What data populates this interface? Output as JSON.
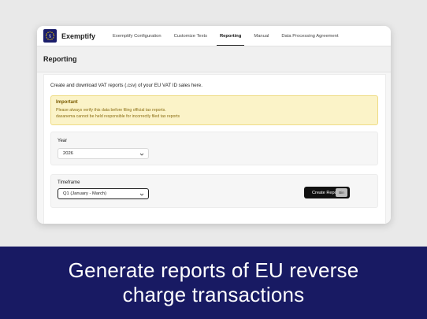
{
  "app": {
    "brand": "Exemptify",
    "nav": [
      {
        "label": "Exemptify Configuration",
        "active": false
      },
      {
        "label": "Customize Texts",
        "active": false
      },
      {
        "label": "Reporting",
        "active": true
      },
      {
        "label": "Manual",
        "active": false
      },
      {
        "label": "Data Processing Agreement",
        "active": false
      }
    ]
  },
  "page": {
    "title": "Reporting",
    "intro": "Create and download VAT reports (.csv) of your EU VAT ID sales here.",
    "notice": {
      "title": "Important",
      "line1": "Please always verify this data before filing official tax reports.",
      "line2": "daxanema cannot be held responsible for incorrectly filed tax reports"
    },
    "year": {
      "label": "Year",
      "value": "2026"
    },
    "timeframe": {
      "label": "Timeframe",
      "value": "Q1 (January - March)"
    },
    "create_button": "Create Report",
    "bin_label": "Bin"
  },
  "banner": {
    "line1": "Generate reports of EU reverse",
    "line2": "charge transactions"
  },
  "colors": {
    "brand_navy": "#181a63",
    "notice_bg": "#fbf3c8",
    "button": "#111111"
  }
}
